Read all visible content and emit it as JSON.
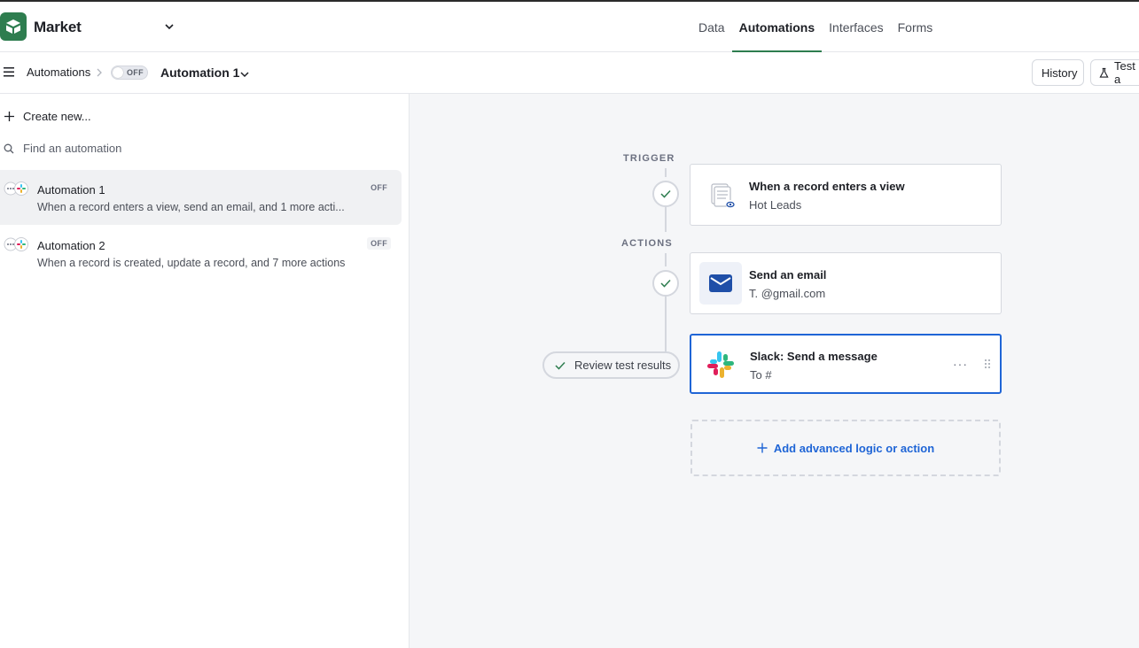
{
  "header": {
    "base_name": "Market",
    "nav_tabs": [
      {
        "label": "Data",
        "active": false
      },
      {
        "label": "Automations",
        "active": true
      },
      {
        "label": "Interfaces",
        "active": false
      },
      {
        "label": "Forms",
        "active": false
      }
    ],
    "brand_color": "#2e7d4f"
  },
  "subbar": {
    "breadcrumb": "Automations",
    "toggle_label": "OFF",
    "automation_title": "Automation 1",
    "history_label": "History",
    "test_label": "Test a"
  },
  "sidebar": {
    "create_new_label": "Create new...",
    "search_placeholder": "Find an automation",
    "items": [
      {
        "name": "Automation 1",
        "description": "When a record enters a view, send an email, and 1 more acti...",
        "status": "OFF",
        "selected": true
      },
      {
        "name": "Automation 2",
        "description": "When a record is created, update a record, and 7 more actions",
        "status": "OFF",
        "selected": false
      }
    ]
  },
  "canvas": {
    "trigger_label": "TRIGGER",
    "actions_label": "ACTIONS",
    "trigger": {
      "title": "When a record enters a view",
      "subtitle": "Hot Leads",
      "icon": "table-view-icon"
    },
    "actions": [
      {
        "title": "Send an email",
        "subtitle": "T.           @gmail.com",
        "icon": "envelope-icon",
        "icon_bg": "#eef1f8"
      },
      {
        "title": "Slack: Send a message",
        "subtitle": "To #",
        "icon": "slack-icon",
        "selected": true
      }
    ],
    "review_label": "Review test results",
    "add_label": "Add advanced logic or action",
    "accent_color": "#1f65d6"
  }
}
